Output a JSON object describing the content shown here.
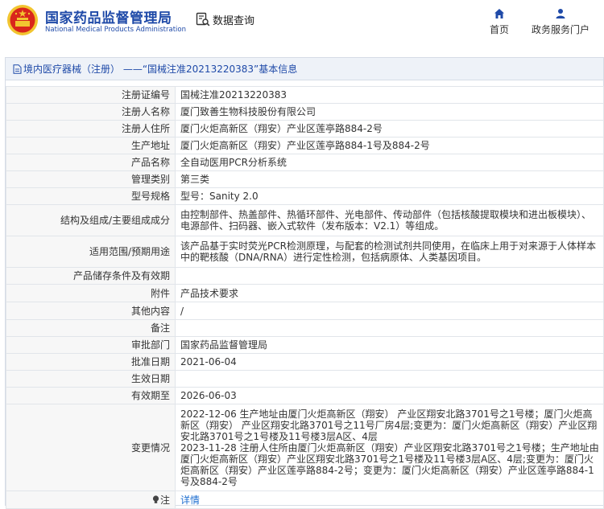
{
  "header": {
    "logo_cn": "国家药品监督管理局",
    "logo_en": "National Medical Products Administration",
    "data_query": "数据查询",
    "nav_home": "首页",
    "nav_portal": "政务服务门户"
  },
  "breadcrumb": {
    "text": "境内医疗器械（注册） ——“国械注准20213220383”基本信息"
  },
  "rows": [
    {
      "label": "注册证编号",
      "value": "国械注准20213220383"
    },
    {
      "label": "注册人名称",
      "value": "厦门致善生物科技股份有限公司"
    },
    {
      "label": "注册人住所",
      "value": "厦门火炬高新区（翔安）产业区莲亭路884-2号"
    },
    {
      "label": "生产地址",
      "value": "厦门火炬高新区（翔安）产业区莲亭路884-1号及884-2号"
    },
    {
      "label": "产品名称",
      "value": "全自动医用PCR分析系统"
    },
    {
      "label": "管理类别",
      "value": "第三类"
    },
    {
      "label": "型号规格",
      "value": "型号：Sanity 2.0"
    },
    {
      "label": "结构及组成/主要组成成分",
      "value": "由控制部件、热盖部件、热循环部件、光电部件、传动部件（包括核酸提取模块和进出板模块）、电源部件、扫码器、嵌入式软件（发布版本：V2.1）等组成。"
    },
    {
      "label": "适用范围/预期用途",
      "value": "该产品基于实时荧光PCR检测原理，与配套的检测试剂共同使用，在临床上用于对来源于人体样本中的靶核酸（DNA/RNA）进行定性检测，包括病原体、人类基因项目。"
    },
    {
      "label": "产品储存条件及有效期",
      "value": ""
    },
    {
      "label": "附件",
      "value": "产品技术要求"
    },
    {
      "label": "其他内容",
      "value": "/"
    },
    {
      "label": "备注",
      "value": ""
    },
    {
      "label": "审批部门",
      "value": "国家药品监督管理局"
    },
    {
      "label": "批准日期",
      "value": "2021-06-04"
    },
    {
      "label": "生效日期",
      "value": ""
    },
    {
      "label": "有效期至",
      "value": "2026-06-03"
    },
    {
      "label": "变更情况",
      "value": "2022-12-06 生产地址由厦门火炬高新区（翔安） 产业区翔安北路3701号之1号楼；厦门火炬高新区（翔安） 产业区翔安北路3701号之11号厂房4层;变更为：厦门火炬高新区（翔安）产业区翔安北路3701号之1号楼及11号楼3层A区、4层\n2023-11-28 注册人住所由厦门火炬高新区（翔安）产业区翔安北路3701号之1号楼；生产地址由厦门火炬高新区（翔安）产业区翔安北路3701号之1号楼及11号楼3层A区、4层;变更为：厦门火炬高新区（翔安）产业区莲亭路884-2号；变更为：厦门火炬高新区（翔安）产业区莲亭路884-1号及884-2号"
    },
    {
      "label": "注",
      "value": "详情"
    }
  ],
  "colors": {
    "brand_blue": "#1f4aa8",
    "emblem_red": "#d9261c",
    "emblem_gold": "#f2c530",
    "link": "#1f6fd0",
    "label_bg": "#f7f7f7",
    "crumb_bg": "#eef2f8"
  },
  "icons": {
    "emblem": "national-emblem-icon",
    "data_query": "document-search-icon",
    "home": "home-icon",
    "portal": "user-icon",
    "breadcrumb": "document-icon",
    "note": "lightbulb-icon"
  }
}
